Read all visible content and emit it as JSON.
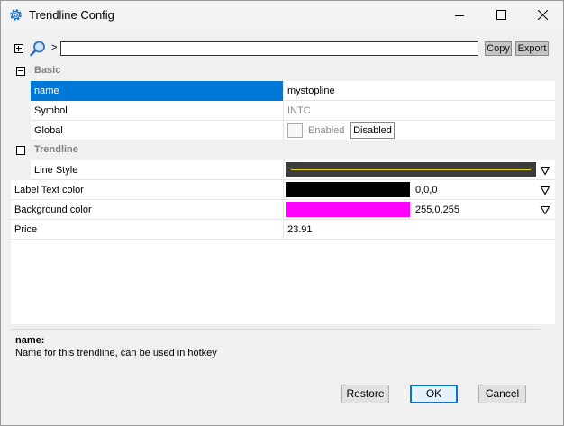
{
  "window": {
    "title": "Trendline Config"
  },
  "toolbar": {
    "breadcrumb_sep": ">",
    "search_value": "",
    "copy_label": "Copy",
    "export_label": "Export"
  },
  "grid": {
    "categories": {
      "basic": "Basic",
      "trendline": "Trendline"
    },
    "rows": {
      "name": {
        "label": "name",
        "value": "mystopline"
      },
      "symbol": {
        "label": "Symbol",
        "value": "INTC"
      },
      "global": {
        "label": "Global",
        "checkbox_label": "Enabled",
        "button_label": "Disabled"
      },
      "line_style": {
        "label": "Line Style",
        "line_color": "#e5d400"
      },
      "label_text_color": {
        "label": "Label Text color",
        "value": "0,0,0",
        "swatch": "#000000"
      },
      "background_color": {
        "label": "Background color",
        "value": "255,0,255",
        "swatch": "#ff00ff"
      },
      "price": {
        "label": "Price",
        "value": "23.91"
      }
    }
  },
  "description": {
    "title": "name:",
    "text": "Name for this trendline, can be used in hotkey"
  },
  "buttons": {
    "restore": "Restore",
    "ok": "OK",
    "cancel": "Cancel"
  },
  "colors": {
    "selection": "#0078d7",
    "category_text": "#808080"
  }
}
